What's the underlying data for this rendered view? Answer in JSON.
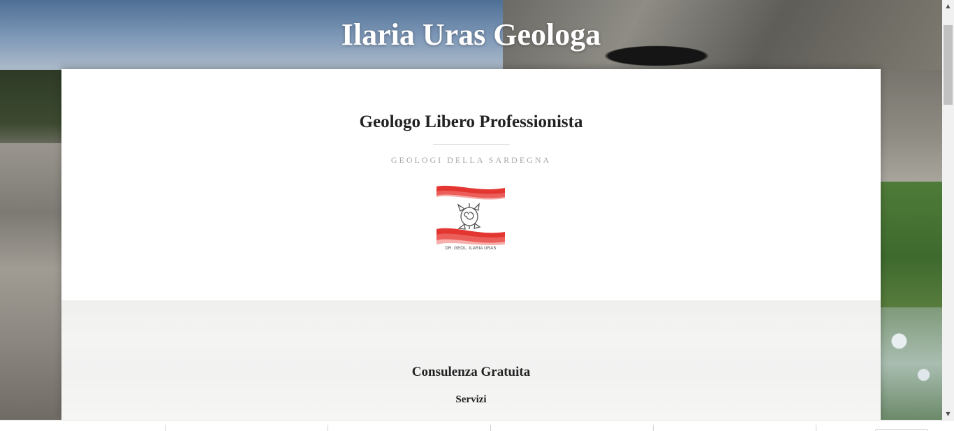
{
  "header": {
    "site_title": "Ilaria Uras Geologa"
  },
  "intro": {
    "heading": "Geologo Libero Professionista",
    "tagline": "GEOLOGI DELLA SARDEGNA",
    "logo_caption": "DR. GEOL. ILARIA URAS"
  },
  "section": {
    "heading": "Consulenza Gratuita",
    "subheading": "Servizi"
  },
  "colors": {
    "logo_red": "#e0201b",
    "text_dark": "#222222",
    "tagline_gray": "#a6a6a6"
  },
  "icons": [
    "turtle-logo-icon",
    "scroll-up-arrow-icon",
    "scroll-down-arrow-icon"
  ]
}
